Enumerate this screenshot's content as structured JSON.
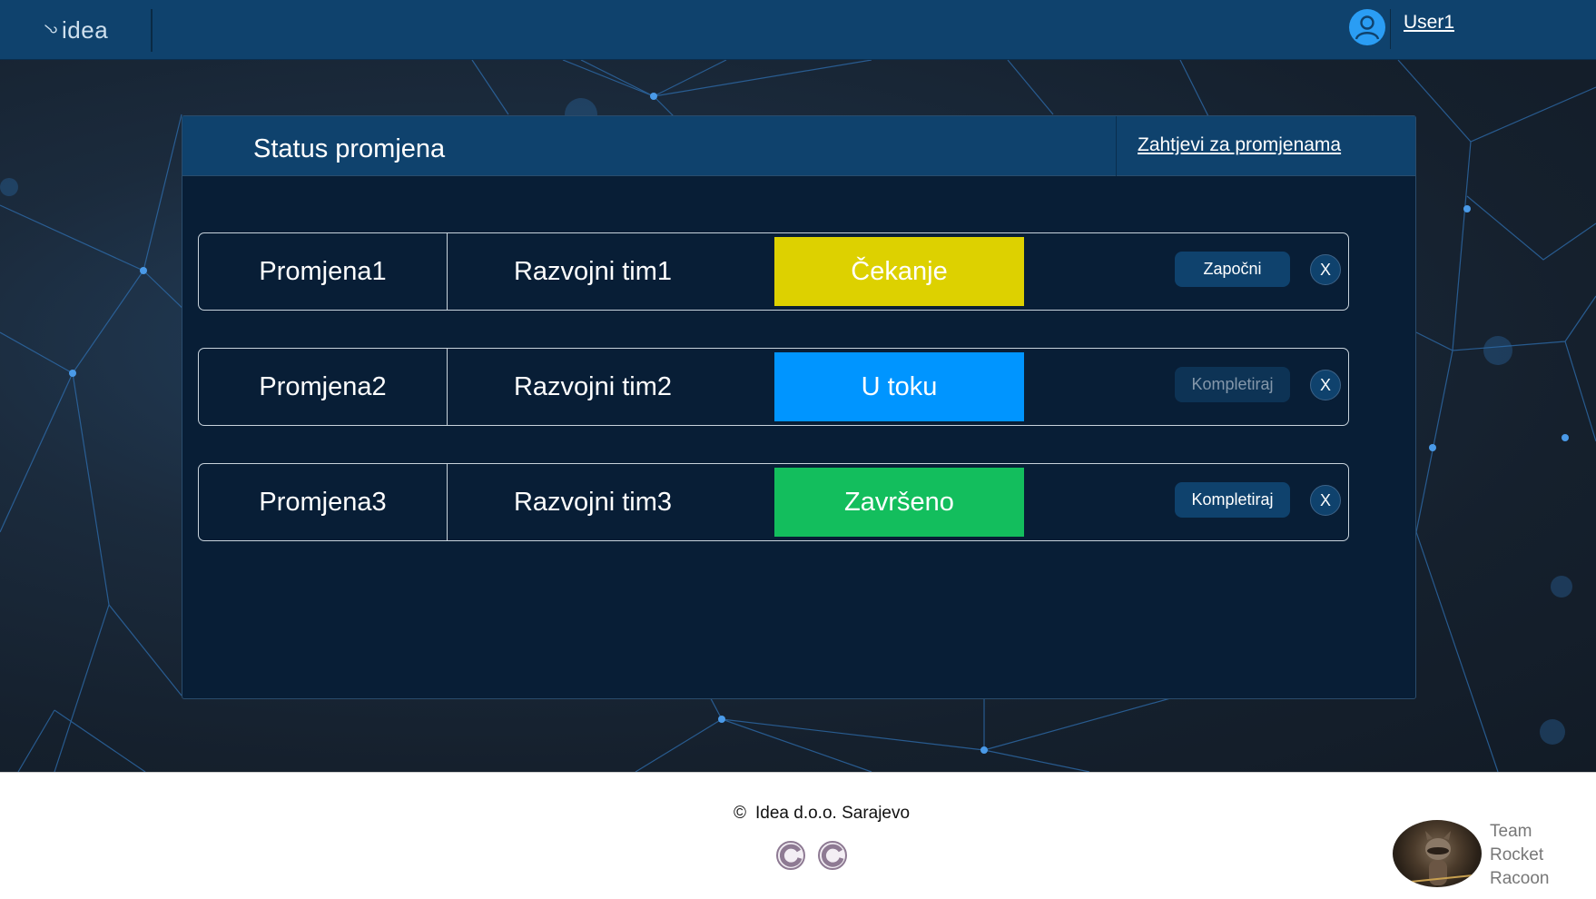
{
  "topbar": {
    "logo_text": "idea",
    "user_name": "User1"
  },
  "panel": {
    "title": "Status promjena",
    "header_link": "Zahtjevi za promjenama"
  },
  "changes": [
    {
      "name": "Promjena1",
      "team": "Razvojni tim1",
      "status": "Čekanje",
      "status_color": "#ddd100",
      "action": "Započni",
      "action_enabled": true,
      "close": "X"
    },
    {
      "name": "Promjena2",
      "team": "Razvojni tim2",
      "status": "U toku",
      "status_color": "#0095ff",
      "action": "Kompletiraj",
      "action_enabled": false,
      "close": "X"
    },
    {
      "name": "Promjena3",
      "team": "Razvojni tim3",
      "status": "Završeno",
      "status_color": "#13be5d",
      "action": "Kompletiraj",
      "action_enabled": true,
      "close": "X"
    }
  ],
  "footer": {
    "copyright_symbol": "©",
    "copyright_text": "Idea d.o.o. Sarajevo",
    "team_line1": "Team",
    "team_line2": "Rocket",
    "team_line3": "Racoon"
  },
  "colors": {
    "header": "#0f426d",
    "panel": "#081e36",
    "accent": "#2a9df4"
  }
}
